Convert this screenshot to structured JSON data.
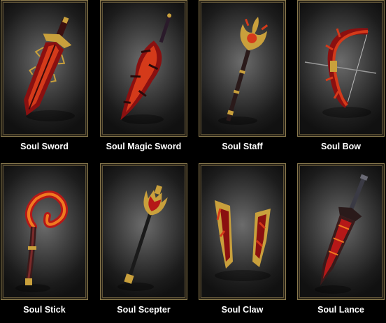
{
  "weapons": [
    {
      "name": "Soul Sword",
      "icon": "soul-sword-icon"
    },
    {
      "name": "Soul Magic Sword",
      "icon": "soul-magic-sword-icon"
    },
    {
      "name": "Soul Staff",
      "icon": "soul-staff-icon"
    },
    {
      "name": "Soul Bow",
      "icon": "soul-bow-icon"
    },
    {
      "name": "Soul Stick",
      "icon": "soul-stick-icon"
    },
    {
      "name": "Soul Scepter",
      "icon": "soul-scepter-icon"
    },
    {
      "name": "Soul Claw",
      "icon": "soul-claw-icon"
    },
    {
      "name": "Soul Lance",
      "icon": "soul-lance-icon"
    }
  ],
  "colors": {
    "frame_border": "#8a7a4e",
    "blade_red": "#b51818",
    "gold": "#c9a03c",
    "dark_metal": "#2a1a1a"
  }
}
